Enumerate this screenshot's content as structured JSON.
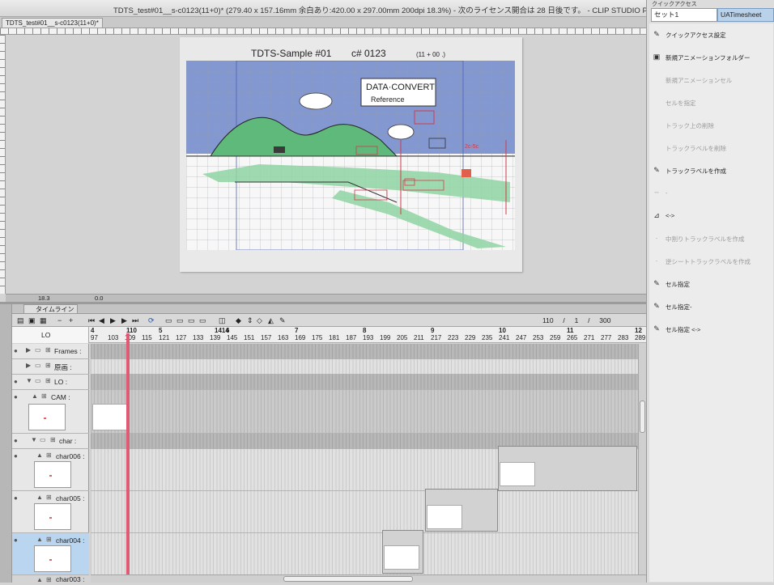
{
  "window": {
    "title": "TDTS_test#01__s-c0123(11+0)* (279.40 x 157.16mm 余白あり:420.00 x 297.00mm 200dpi 18.3%) - 次のライセンス開合は 28 日後です。 - CLIP STUDIO PAINT"
  },
  "document_tab": "TDTS_test#01__s-c0123(11+0)*",
  "canvas": {
    "header_title": "TDTS-Sample #01",
    "header_cut": "c# 0123",
    "header_frames": "(11 + 00 .)",
    "drawing_texts": {
      "data_convert": "DATA·CONVERT",
      "reference": "Reference",
      "note_2c": "2c-5c"
    }
  },
  "canvas_status": {
    "zoom": "18.3",
    "angle": "0.0"
  },
  "timeline": {
    "tab_label": "タイムライン",
    "frame_status": {
      "current": "110",
      "sep1": "/",
      "mid": "1",
      "sep2": "/",
      "total": "300"
    },
    "layer_selector": "LO",
    "seconds_row": [
      {
        "label": "4"
      },
      {
        "label": "110"
      },
      {
        "label": "5"
      },
      {
        "label": "1414"
      },
      {
        "label": "6"
      },
      {
        "label": "7"
      },
      {
        "label": "8"
      },
      {
        "label": "9"
      },
      {
        "label": "10"
      },
      {
        "label": "11"
      },
      {
        "label": "12"
      }
    ],
    "frame_numbers": [
      "97",
      "103",
      "109",
      "115",
      "121",
      "127",
      "133",
      "139",
      "145",
      "151",
      "157",
      "163",
      "169",
      "175",
      "181",
      "187",
      "193",
      "199",
      "205",
      "211",
      "217",
      "223",
      "229",
      "235",
      "241",
      "247",
      "253",
      "259",
      "265",
      "271",
      "277",
      "283",
      "289"
    ],
    "layers": [
      {
        "name": "Frames :",
        "type": "folder"
      },
      {
        "name": "原画 :",
        "type": "folder"
      },
      {
        "name": "LO :",
        "type": "folder"
      },
      {
        "name": "CAM :",
        "type": "layer"
      },
      {
        "name": "char :",
        "type": "folder"
      },
      {
        "name": "char006 :",
        "type": "layer"
      },
      {
        "name": "char005 :",
        "type": "layer"
      },
      {
        "name": "char004 :",
        "type": "layer"
      },
      {
        "name": "char003 :",
        "type": "layer"
      }
    ]
  },
  "right_panel": {
    "tab_label": "クイックアクセス",
    "set_name": "セット1",
    "sheet_name": "UATimesheet",
    "items": [
      {
        "label": "クイックアクセス設定",
        "icon": "pin-icon",
        "enabled": true
      },
      {
        "label": "新規アニメーションフォルダー",
        "icon": "folder-plus-icon",
        "enabled": true
      },
      {
        "label": "新規アニメーションセル",
        "icon": "",
        "enabled": false
      },
      {
        "label": "セルを指定",
        "icon": "",
        "enabled": false
      },
      {
        "label": "トラック上の削除",
        "icon": "",
        "enabled": false
      },
      {
        "label": "トラックラベルを削除",
        "icon": "",
        "enabled": false
      },
      {
        "label": "トラックラベルを作成",
        "icon": "pen-icon",
        "enabled": true
      },
      {
        "label": "-",
        "icon": "dash-icon",
        "enabled": false
      },
      {
        "label": "<->",
        "icon": "arrow-icon",
        "enabled": true
      },
      {
        "label": "中割りトラックラベルを作成",
        "icon": "dot-icon",
        "enabled": false
      },
      {
        "label": "逆シートトラックラベルを作成",
        "icon": "dot-icon",
        "enabled": false
      },
      {
        "label": "セル指定",
        "icon": "pen-icon",
        "enabled": true
      },
      {
        "label": "セル指定-",
        "icon": "pen-icon",
        "enabled": true
      },
      {
        "label": "セル指定 <->",
        "icon": "pen-icon",
        "enabled": true
      }
    ]
  }
}
